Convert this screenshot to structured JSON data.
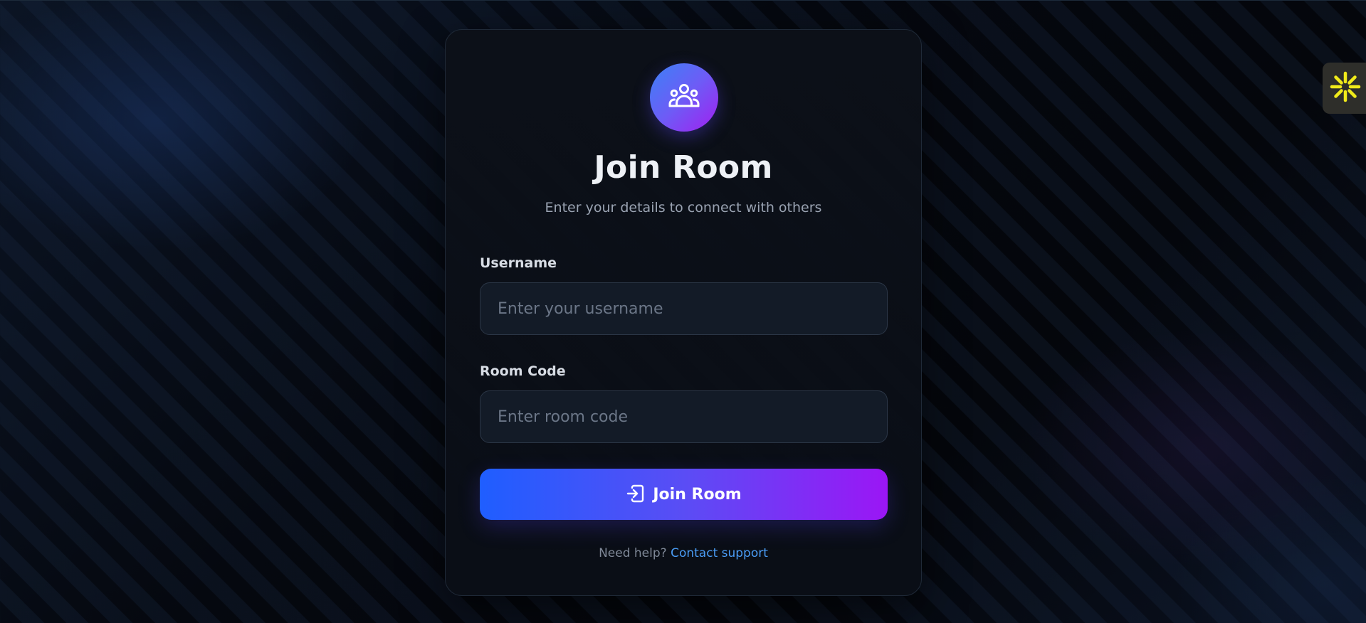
{
  "card": {
    "title": "Join Room",
    "subtitle": "Enter your details to connect with others",
    "logo_icon": "users-group-icon"
  },
  "form": {
    "username": {
      "label": "Username",
      "value": "",
      "placeholder": "Enter your username"
    },
    "room_code": {
      "label": "Room Code",
      "value": "",
      "placeholder": "Enter room code"
    },
    "submit": {
      "label": "Join Room",
      "icon": "login-icon"
    }
  },
  "help": {
    "text": "Need help?",
    "link_label": "Contact support"
  },
  "side_widget": {
    "icon": "sparkle-icon",
    "color": "#f0ea1a"
  },
  "colors": {
    "accent_start": "#1f5eff",
    "accent_end": "#9b16f5",
    "link": "#4a9cf5",
    "background": "#04070d"
  }
}
